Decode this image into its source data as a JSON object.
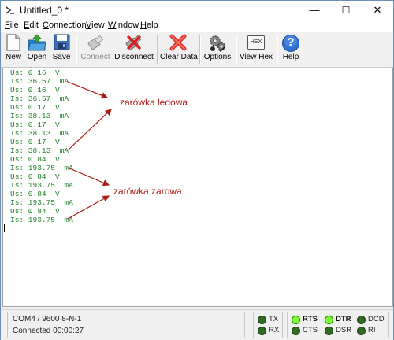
{
  "window": {
    "title": "Untitled_0 *",
    "minimize": "—",
    "maximize": "☐",
    "close": "✕"
  },
  "menu": [
    {
      "label": "File",
      "key": "F",
      "rest": "ile"
    },
    {
      "label": "Edit",
      "key": "E",
      "rest": "dit"
    },
    {
      "label": "Connection",
      "key": "C",
      "rest": "onnection"
    },
    {
      "label": "View",
      "key": "V",
      "rest": "iew"
    },
    {
      "label": "Window",
      "key": "W",
      "rest": "indow"
    },
    {
      "label": "Help",
      "key": "H",
      "rest": "elp"
    }
  ],
  "toolbar": {
    "new": "New",
    "open": "Open",
    "save": "Save",
    "connect": "Connect",
    "disconnect": "Disconnect",
    "clear": "Clear Data",
    "options": "Options",
    "view_hex": "View Hex",
    "help": "Help",
    "hex_icon_text": "HEX",
    "help_icon_text": "?"
  },
  "terminal": {
    "lines": [
      "Us: 0.16  V",
      "Is: 36.57  mA",
      "Us: 0.16  V",
      "Is: 36.57  mA",
      "Us: 0.17  V",
      "Is: 38.13  mA",
      "Us: 0.17  V",
      "Is: 38.13  mA",
      "Us: 0.17  V",
      "Is: 38.13  mA",
      "Us: 0.84  V",
      "Is: 193.75  mA",
      "Us: 0.84  V",
      "Is: 193.75  mA",
      "Us: 0.84  V",
      "Is: 193.75  mA",
      "Us: 0.84  V",
      "Is: 193.75  mA"
    ],
    "annotation_led": "zarówka ledowa",
    "annotation_incandescent": "zarówka zarowa"
  },
  "status": {
    "port": "COM4 / 9600 8-N-1",
    "connected": "Connected 00:00:27",
    "leds": {
      "tx": {
        "label": "TX",
        "on": false
      },
      "rx": {
        "label": "RX",
        "on": false
      },
      "rts": {
        "label": "RTS",
        "on": true
      },
      "cts": {
        "label": "CTS",
        "on": false
      },
      "dtr": {
        "label": "DTR",
        "on": true
      },
      "dsr": {
        "label": "DSR",
        "on": false
      },
      "dcd": {
        "label": "DCD",
        "on": false
      },
      "ri": {
        "label": "RI",
        "on": false
      }
    }
  },
  "colors": {
    "terminal_text": "#1f7f2b",
    "annotation": "#b01818",
    "led_on": "#7cff36",
    "led_off": "#2f6b20"
  }
}
